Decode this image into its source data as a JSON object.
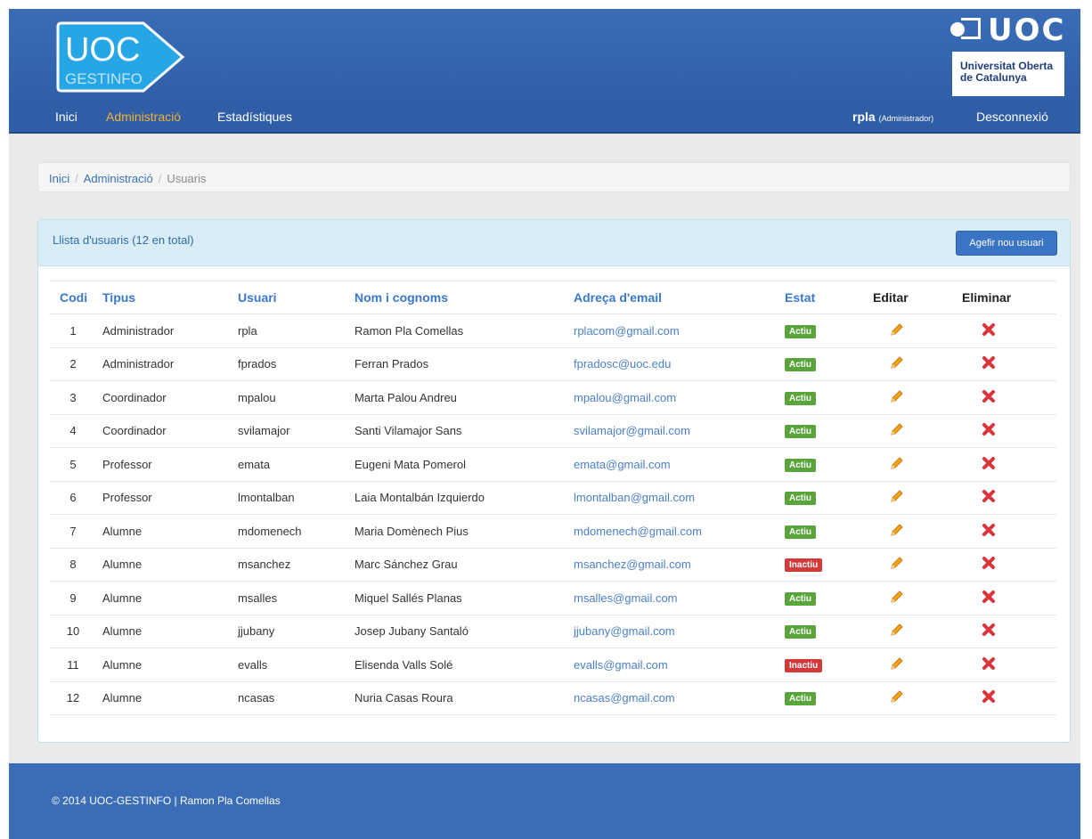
{
  "brand": {
    "app_logo_top": "UOC",
    "app_logo_bottom": "GESTINFO",
    "uni_logo_word": "UOC",
    "uni_name_line1": "Universitat Oberta",
    "uni_name_line2": "de Catalunya"
  },
  "nav": {
    "items": [
      {
        "label": "Inici"
      },
      {
        "label": "Administració"
      },
      {
        "label": "Estadístiques"
      }
    ],
    "user_name": "rpla",
    "user_role": "(Administrador)",
    "logout": "Desconnexió"
  },
  "breadcrumb": {
    "items": [
      "Inici",
      "Administració",
      "Usuaris"
    ],
    "separator": "/"
  },
  "panel": {
    "title": "Llista d'usuaris (12 en total)",
    "add_button": "Agefir nou usuari"
  },
  "table": {
    "headers": [
      "Codi",
      "Tipus",
      "Usuari",
      "Nom i cognoms",
      "Adreça d'email",
      "Estat",
      "Editar",
      "Eliminar"
    ],
    "rows": [
      {
        "codi": "1",
        "tipus": "Administrador",
        "usuari": "rpla",
        "nom": "Ramon Pla Comellas",
        "email": "rplacom@gmail.com",
        "estat": "Actiu"
      },
      {
        "codi": "2",
        "tipus": "Administrador",
        "usuari": "fprados",
        "nom": "Ferran Prados",
        "email": "fpradosc@uoc.edu",
        "estat": "Actiu"
      },
      {
        "codi": "3",
        "tipus": "Coordinador",
        "usuari": "mpalou",
        "nom": "Marta Palou Andreu",
        "email": "mpalou@gmail.com",
        "estat": "Actiu"
      },
      {
        "codi": "4",
        "tipus": "Coordinador",
        "usuari": "svilamajor",
        "nom": "Santi Vilamajor Sans",
        "email": "svilamajor@gmail.com",
        "estat": "Actiu"
      },
      {
        "codi": "5",
        "tipus": "Professor",
        "usuari": "emata",
        "nom": "Eugeni Mata Pomerol",
        "email": "emata@gmail.com",
        "estat": "Actiu"
      },
      {
        "codi": "6",
        "tipus": "Professor",
        "usuari": "lmontalban",
        "nom": "Laia Montalbán Izquierdo",
        "email": "lmontalban@gmail.com",
        "estat": "Actiu"
      },
      {
        "codi": "7",
        "tipus": "Alumne",
        "usuari": "mdomenech",
        "nom": "Maria Domènech Pius",
        "email": "mdomenech@gmail.com",
        "estat": "Actiu"
      },
      {
        "codi": "8",
        "tipus": "Alumne",
        "usuari": "msanchez",
        "nom": "Marc Sánchez Grau",
        "email": "msanchez@gmail.com",
        "estat": "Inactiu"
      },
      {
        "codi": "9",
        "tipus": "Alumne",
        "usuari": "msalles",
        "nom": "Miquel Sallés Planas",
        "email": "msalles@gmail.com",
        "estat": "Actiu"
      },
      {
        "codi": "10",
        "tipus": "Alumne",
        "usuari": "jjubany",
        "nom": "Josep Jubany Santaló",
        "email": "jjubany@gmail.com",
        "estat": "Actiu"
      },
      {
        "codi": "11",
        "tipus": "Alumne",
        "usuari": "evalls",
        "nom": "Elisenda Valls Solé",
        "email": "evalls@gmail.com",
        "estat": "Inactiu"
      },
      {
        "codi": "12",
        "tipus": "Alumne",
        "usuari": "ncasas",
        "nom": "Nuria Casas Roura",
        "email": "ncasas@gmail.com",
        "estat": "Actiu"
      }
    ],
    "edit_icon": "pencil-icon",
    "delete_icon": "delete-x-icon"
  },
  "footer": {
    "text": "© 2014 UOC-GESTINFO | Ramon Pla Comellas"
  },
  "colors": {
    "header_blue": "#2f5fa8",
    "active_nav": "#f2b233",
    "badge_active": "#5aa53b",
    "badge_inactive": "#d23a3a",
    "link_blue": "#3a78c9"
  }
}
